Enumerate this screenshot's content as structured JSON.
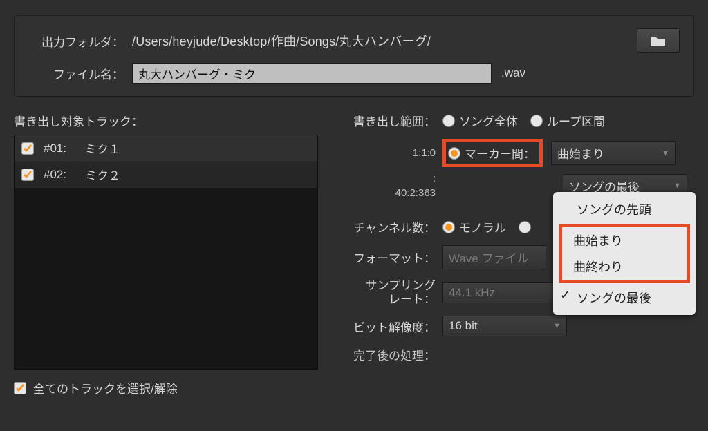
{
  "top": {
    "folder_label": "出力フォルダ：",
    "folder_path": "/Users/heyjude/Desktop/作曲/Songs/丸大ハンバーグ/",
    "filename_label": "ファイル名：",
    "filename_value": "丸大ハンバーグ・ミク",
    "extension": ".wav"
  },
  "tracks": {
    "heading": "書き出し対象トラック：",
    "items": [
      {
        "id": "#01:",
        "name": "ミク１"
      },
      {
        "id": "#02:",
        "name": "ミク２"
      }
    ],
    "select_all": "全てのトラックを選択/解除"
  },
  "range": {
    "heading": "書き出し範囲：",
    "opt_song": "ソング全体",
    "opt_loop": "ループ区間",
    "opt_marker": "マーカー間：",
    "time_start": "1:1:0",
    "time_colon": ":",
    "time_end": "40:2:363",
    "combo_start": "曲始まり",
    "combo_end": "ソングの最後",
    "dropdown": {
      "top": "ソングの先頭",
      "mid1": "曲始まり",
      "mid2": "曲終わり",
      "bottom": "ソングの最後"
    }
  },
  "channels": {
    "label": "チャンネル数：",
    "mono": "モノラル"
  },
  "format": {
    "label": "フォーマット：",
    "value": "Wave ファイル"
  },
  "sampling": {
    "label1": "サンプリング",
    "label2": "レート：",
    "value": "44.1 kHz"
  },
  "bit": {
    "label": "ビット解像度：",
    "value": "16 bit"
  },
  "post": {
    "label": "完了後の処理："
  }
}
